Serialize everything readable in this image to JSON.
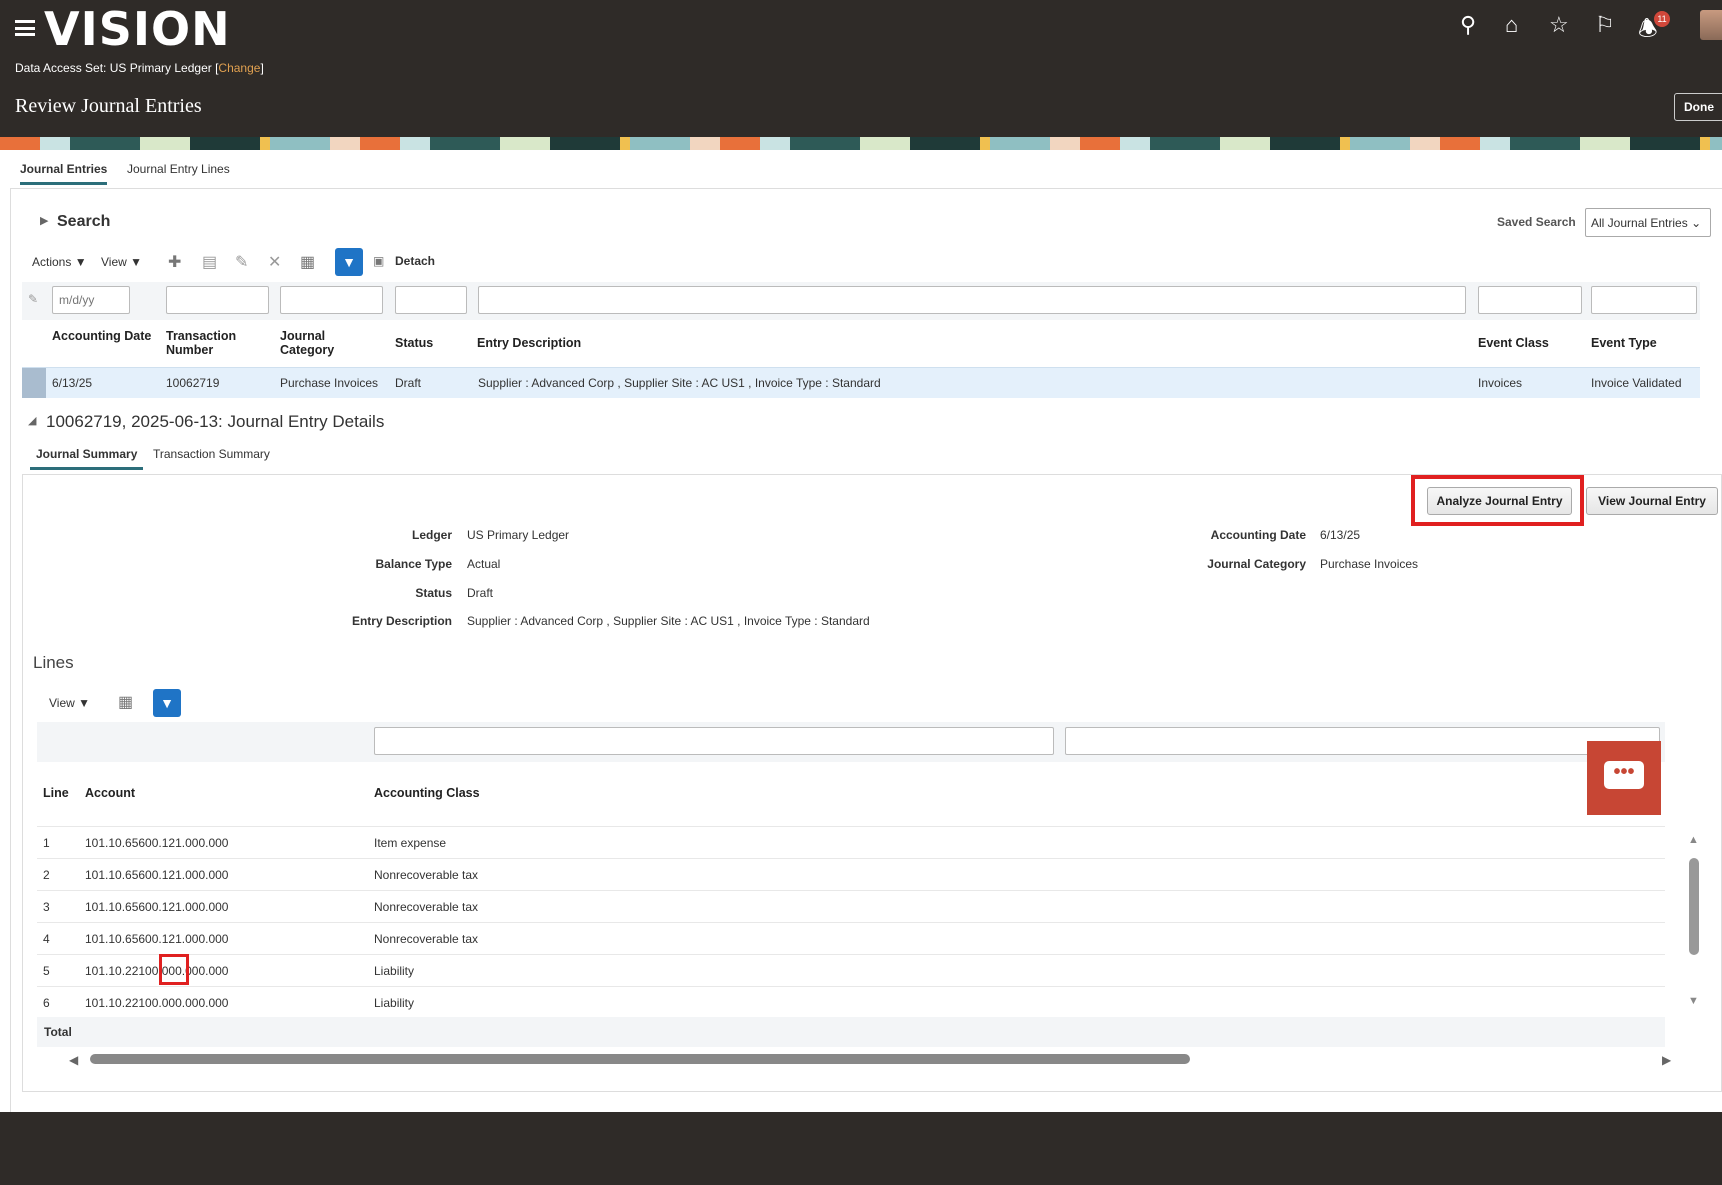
{
  "app": {
    "logo": "VISION",
    "data_access_label": "Data Access Set: US Primary Ledger",
    "change_link": "Change",
    "page_title": "Review Journal Entries",
    "done_label": "Done",
    "notification_count": "11"
  },
  "tabs": [
    "Journal Entries",
    "Journal Entry Lines"
  ],
  "search": {
    "label": "Search",
    "saved_search_label": "Saved Search",
    "saved_search_value": "All Journal Entries"
  },
  "toolbar": {
    "actions": "Actions",
    "view": "View",
    "detach": "Detach"
  },
  "filter": {
    "date_placeholder": "m/d/yy"
  },
  "table": {
    "headers": [
      "Accounting Date",
      "Transaction Number",
      "Journal Category",
      "Status",
      "Entry Description",
      "Event Class",
      "Event Type"
    ],
    "rows": [
      [
        "6/13/25",
        "10062719",
        "Purchase Invoices",
        "Draft",
        "Supplier : Advanced Corp , Supplier Site : AC US1 , Invoice Type : Standard",
        "Invoices",
        "Invoice Validated"
      ]
    ]
  },
  "details": {
    "title": "10062719, 2025-06-13: Journal Entry Details",
    "tabs": [
      "Journal Summary",
      "Transaction Summary"
    ],
    "analyze_button": "Analyze Journal Entry",
    "view_button": "View Journal Entry",
    "fields": [
      {
        "label": "Ledger",
        "value": "US Primary Ledger"
      },
      {
        "label": "Balance Type",
        "value": "Actual"
      },
      {
        "label": "Status",
        "value": "Draft"
      },
      {
        "label": "Entry Description",
        "value": "Supplier : Advanced Corp , Supplier Site : AC US1 , Invoice Type : Standard"
      }
    ],
    "right_fields": [
      {
        "label": "Accounting Date",
        "value": "6/13/25"
      },
      {
        "label": "Journal Category",
        "value": "Purchase Invoices"
      }
    ]
  },
  "lines": {
    "title": "Lines",
    "view": "View",
    "headers": [
      "Line",
      "Account",
      "Accounting Class"
    ],
    "rows": [
      [
        "1",
        "101.10.65600.121.000.000",
        "Item expense"
      ],
      [
        "2",
        "101.10.65600.121.000.000",
        "Nonrecoverable tax"
      ],
      [
        "3",
        "101.10.65600.121.000.000",
        "Nonrecoverable tax"
      ],
      [
        "4",
        "101.10.65600.121.000.000",
        "Nonrecoverable tax"
      ],
      [
        "5",
        "101.10.22100.000.000.000",
        "Liability"
      ],
      [
        "6",
        "101.10.22100.000.000.000",
        "Liability"
      ]
    ],
    "total_label": "Total"
  },
  "colors": {
    "header_bg": "#2f2b28",
    "accent": "#1f74c6",
    "highlight": "#e02020",
    "chat": "#c74634",
    "selected_row": "#e4f0fb"
  }
}
